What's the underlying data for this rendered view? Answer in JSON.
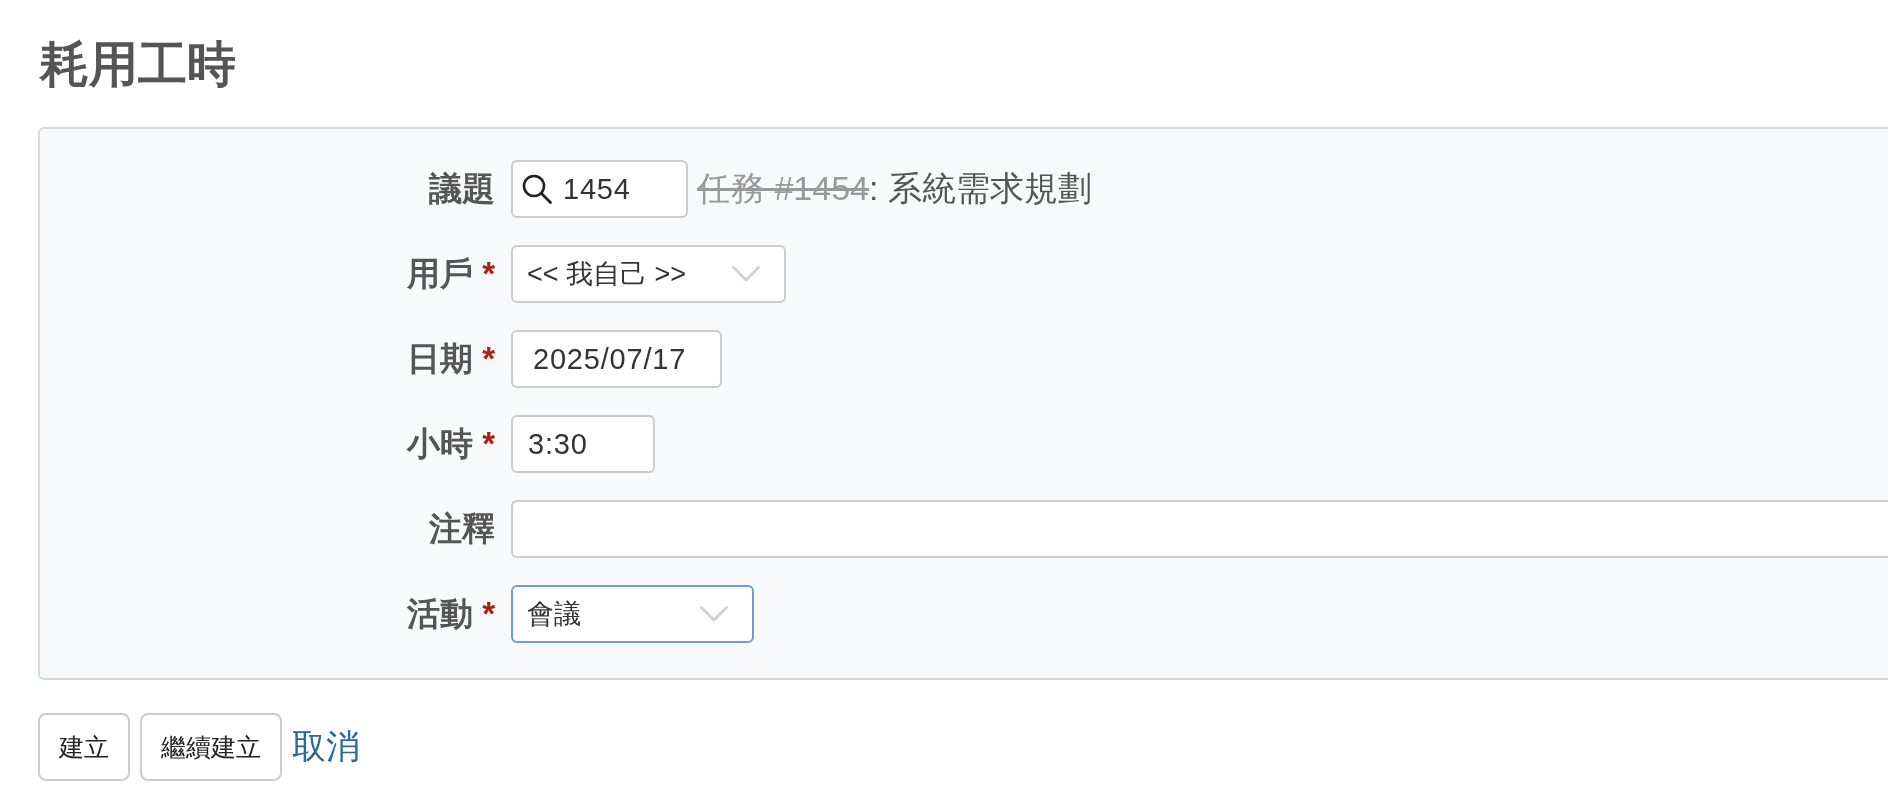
{
  "page": {
    "title": "耗用工時"
  },
  "form": {
    "fields": [
      {
        "kind": "issue",
        "label": "議題",
        "value": "1454",
        "focused": false,
        "issue": {
          "ref": "任務 #1454",
          "closed": true,
          "subject": ": 系統需求規劃"
        }
      },
      {
        "kind": "select",
        "label": "用戶",
        "required_mark": "*",
        "value": "<< 我自己 >>",
        "focused": false
      },
      {
        "kind": "date",
        "label": "日期",
        "required_mark": "*",
        "value": "2025/07/17",
        "focused": false
      },
      {
        "kind": "input",
        "label": "小時",
        "required_mark": "*",
        "value": "3:30",
        "focused": false
      },
      {
        "kind": "wide_input",
        "label": "注釋",
        "focused": false
      },
      {
        "kind": "select",
        "label": "活動",
        "required_mark": "*",
        "value": "會議",
        "focused": true
      }
    ]
  },
  "actions": [
    {
      "kind": "button",
      "label": "建立"
    },
    {
      "kind": "button",
      "label": "繼續建立"
    },
    {
      "kind": "link",
      "label": "取消"
    }
  ]
}
